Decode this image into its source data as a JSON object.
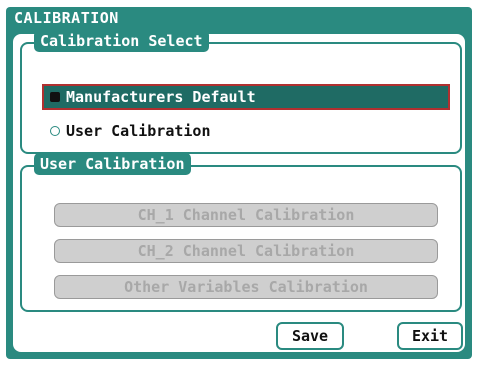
{
  "window": {
    "title": "CALIBRATION"
  },
  "calibration_select": {
    "label": "Calibration Select",
    "options": [
      {
        "label": "Manufacturers Default",
        "checked": true
      },
      {
        "label": "User Calibration",
        "checked": false
      }
    ]
  },
  "user_calibration": {
    "label": "User Calibration",
    "buttons": [
      {
        "label": "CH_1 Channel Calibration",
        "enabled": false
      },
      {
        "label": "CH_2 Channel Calibration",
        "enabled": false
      },
      {
        "label": "Other Variables Calibration",
        "enabled": false
      }
    ]
  },
  "actions": {
    "save_label": "Save",
    "exit_label": "Exit"
  },
  "colors": {
    "accent": "#2a8a80",
    "selected_row": "#1f6b64",
    "selected_border": "#b03030",
    "disabled_button": "#cfcfcf"
  }
}
